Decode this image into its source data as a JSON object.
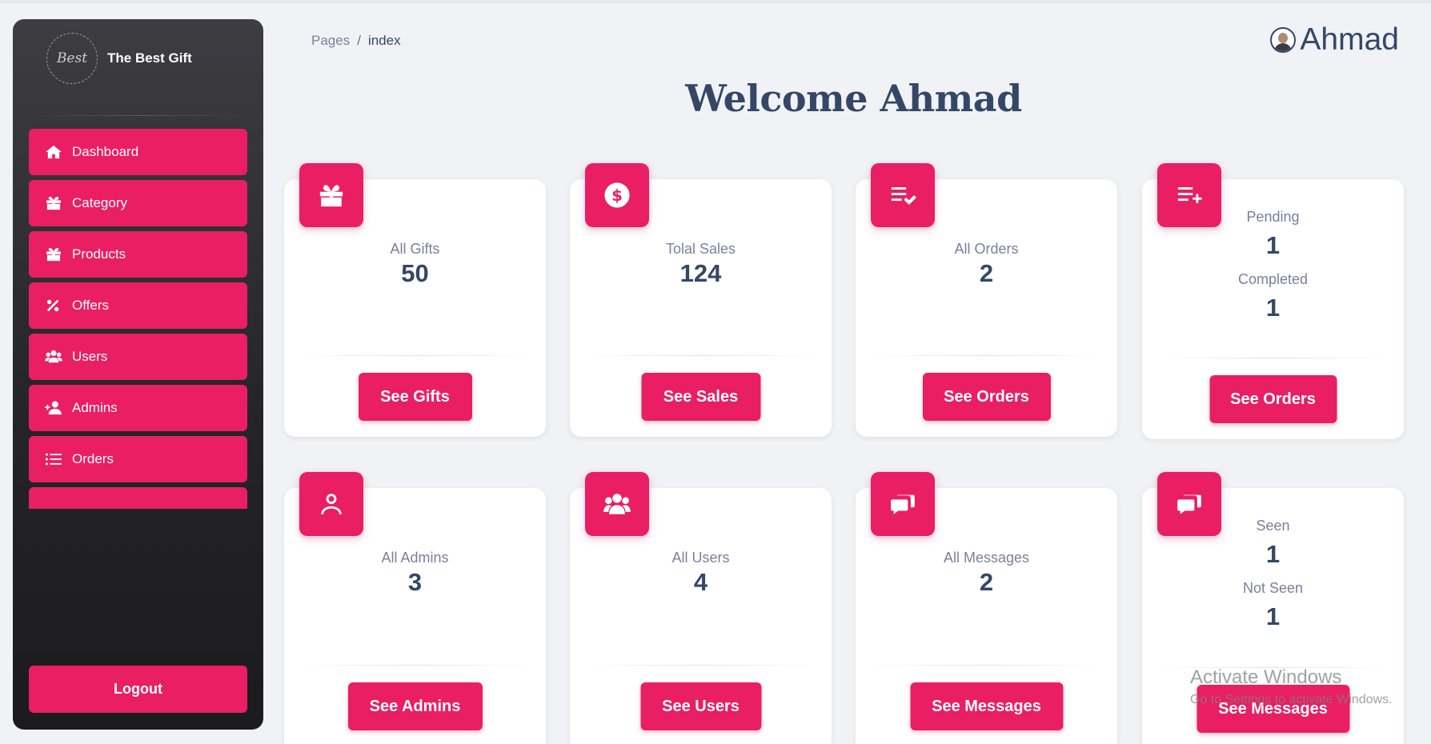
{
  "brand": {
    "logo_text": "Best",
    "name": "The Best Gift"
  },
  "sidebar": {
    "items": [
      {
        "label": "Dashboard",
        "icon": "home-icon"
      },
      {
        "label": "Category",
        "icon": "gift-icon"
      },
      {
        "label": "Products",
        "icon": "gift-icon"
      },
      {
        "label": "Offers",
        "icon": "percent-icon"
      },
      {
        "label": "Users",
        "icon": "users-icon"
      },
      {
        "label": "Admins",
        "icon": "add-user-icon"
      },
      {
        "label": "Orders",
        "icon": "list-icon"
      }
    ],
    "logout_label": "Logout"
  },
  "breadcrumb": {
    "parent": "Pages",
    "separator": "/",
    "current": "index"
  },
  "user": {
    "name": "Ahmad"
  },
  "welcome": "Welcome Ahmad",
  "cards": [
    {
      "icon": "gift-icon",
      "label": "All Gifts",
      "value": "50",
      "button": "See Gifts"
    },
    {
      "icon": "dollar-icon",
      "label": "Tolal Sales",
      "value": "124",
      "button": "See Sales"
    },
    {
      "icon": "playlist-check-icon",
      "label": "All Orders",
      "value": "2",
      "button": "See Orders"
    },
    {
      "icon": "playlist-add-icon",
      "label1": "Pending",
      "value1": "1",
      "label2": "Completed",
      "value2": "1",
      "button": "See Orders"
    },
    {
      "icon": "person-icon",
      "label": "All Admins",
      "value": "3",
      "button": "See Admins"
    },
    {
      "icon": "group-icon",
      "label": "All Users",
      "value": "4",
      "button": "See Users"
    },
    {
      "icon": "chat-icon",
      "label": "All Messages",
      "value": "2",
      "button": "See Messages"
    },
    {
      "icon": "chat-icon",
      "label1": "Seen",
      "value1": "1",
      "label2": "Not Seen",
      "value2": "1",
      "button": "See Messages"
    }
  ],
  "watermark": {
    "title": "Activate Windows",
    "subtitle": "Go to Settings to activate Windows."
  },
  "colors": {
    "accent": "#e91e63",
    "text": "#344767",
    "muted": "#7b809a",
    "background": "#f0f2f5",
    "sidebar": "#252529"
  }
}
